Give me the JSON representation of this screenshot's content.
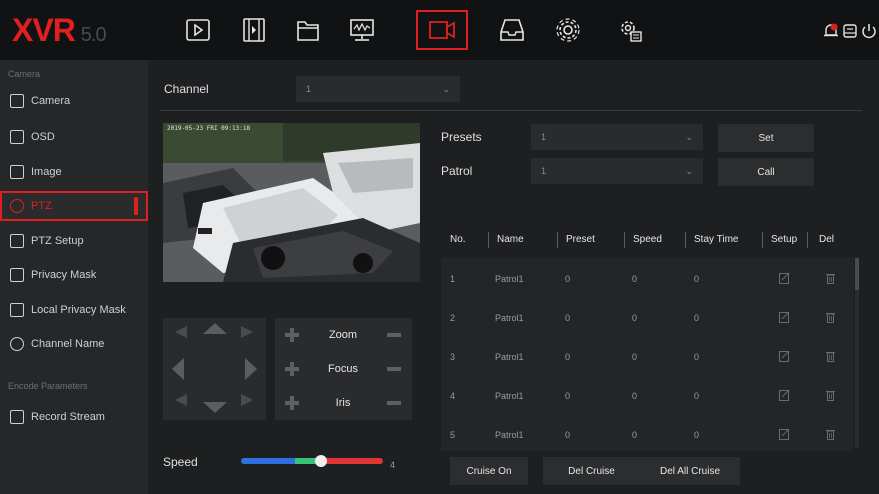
{
  "app": {
    "logo": "XVR",
    "version": "5.0"
  },
  "toolbar": {
    "icons": [
      "playback-icon",
      "video-clip-icon",
      "folder-icon",
      "monitor-icon",
      "camera-icon",
      "storage-icon",
      "settings-gear-icon",
      "system-config-icon"
    ],
    "active": "camera-icon",
    "right_icons": [
      "alarm-bell-icon",
      "notification-icon",
      "power-icon"
    ]
  },
  "sidebar": {
    "section_camera": "Camera",
    "section_encode": "Encode Parameters",
    "items": [
      {
        "label": "Camera",
        "icon": "camera-icon"
      },
      {
        "label": "OSD",
        "icon": "osd-icon"
      },
      {
        "label": "Image",
        "icon": "image-icon"
      },
      {
        "label": "PTZ",
        "icon": "ptz-icon"
      },
      {
        "label": "PTZ Setup",
        "icon": "ptz-setup-icon"
      },
      {
        "label": "Privacy Mask",
        "icon": "privacy-mask-icon"
      },
      {
        "label": "Local Privacy Mask",
        "icon": "local-privacy-mask-icon"
      },
      {
        "label": "Channel Name",
        "icon": "channel-name-icon"
      },
      {
        "label": "Record Stream",
        "icon": "record-stream-icon"
      }
    ],
    "active_item": "PTZ"
  },
  "main": {
    "channel_label": "Channel",
    "channel_value": "1",
    "video_timestamp": "2019-05-23 FRI 09:13:18",
    "presets_label": "Presets",
    "presets_value": "1",
    "patrol_label": "Patrol",
    "patrol_value": "1",
    "set_button": "Set",
    "call_button": "Call",
    "zoom_label": "Zoom",
    "focus_label": "Focus",
    "iris_label": "Iris",
    "speed_label": "Speed",
    "speed_value": "4",
    "speed_fraction": 0.56,
    "cruise_on": "Cruise On",
    "del_cruise": "Del Cruise",
    "del_all_cruise": "Del All Cruise"
  },
  "table": {
    "headers": [
      "No.",
      "Name",
      "Preset",
      "Speed",
      "Stay Time",
      "Setup",
      "Del"
    ],
    "rows": [
      {
        "no": "1",
        "name": "Patrol1",
        "preset": "0",
        "speed": "0",
        "stay": "0"
      },
      {
        "no": "2",
        "name": "Patrol1",
        "preset": "0",
        "speed": "0",
        "stay": "0"
      },
      {
        "no": "3",
        "name": "Patrol1",
        "preset": "0",
        "speed": "0",
        "stay": "0"
      },
      {
        "no": "4",
        "name": "Patrol1",
        "preset": "0",
        "speed": "0",
        "stay": "0"
      },
      {
        "no": "5",
        "name": "Patrol1",
        "preset": "0",
        "speed": "0",
        "stay": "0"
      }
    ]
  },
  "colors": {
    "accent": "#e02020",
    "background": "#1e1f21"
  }
}
